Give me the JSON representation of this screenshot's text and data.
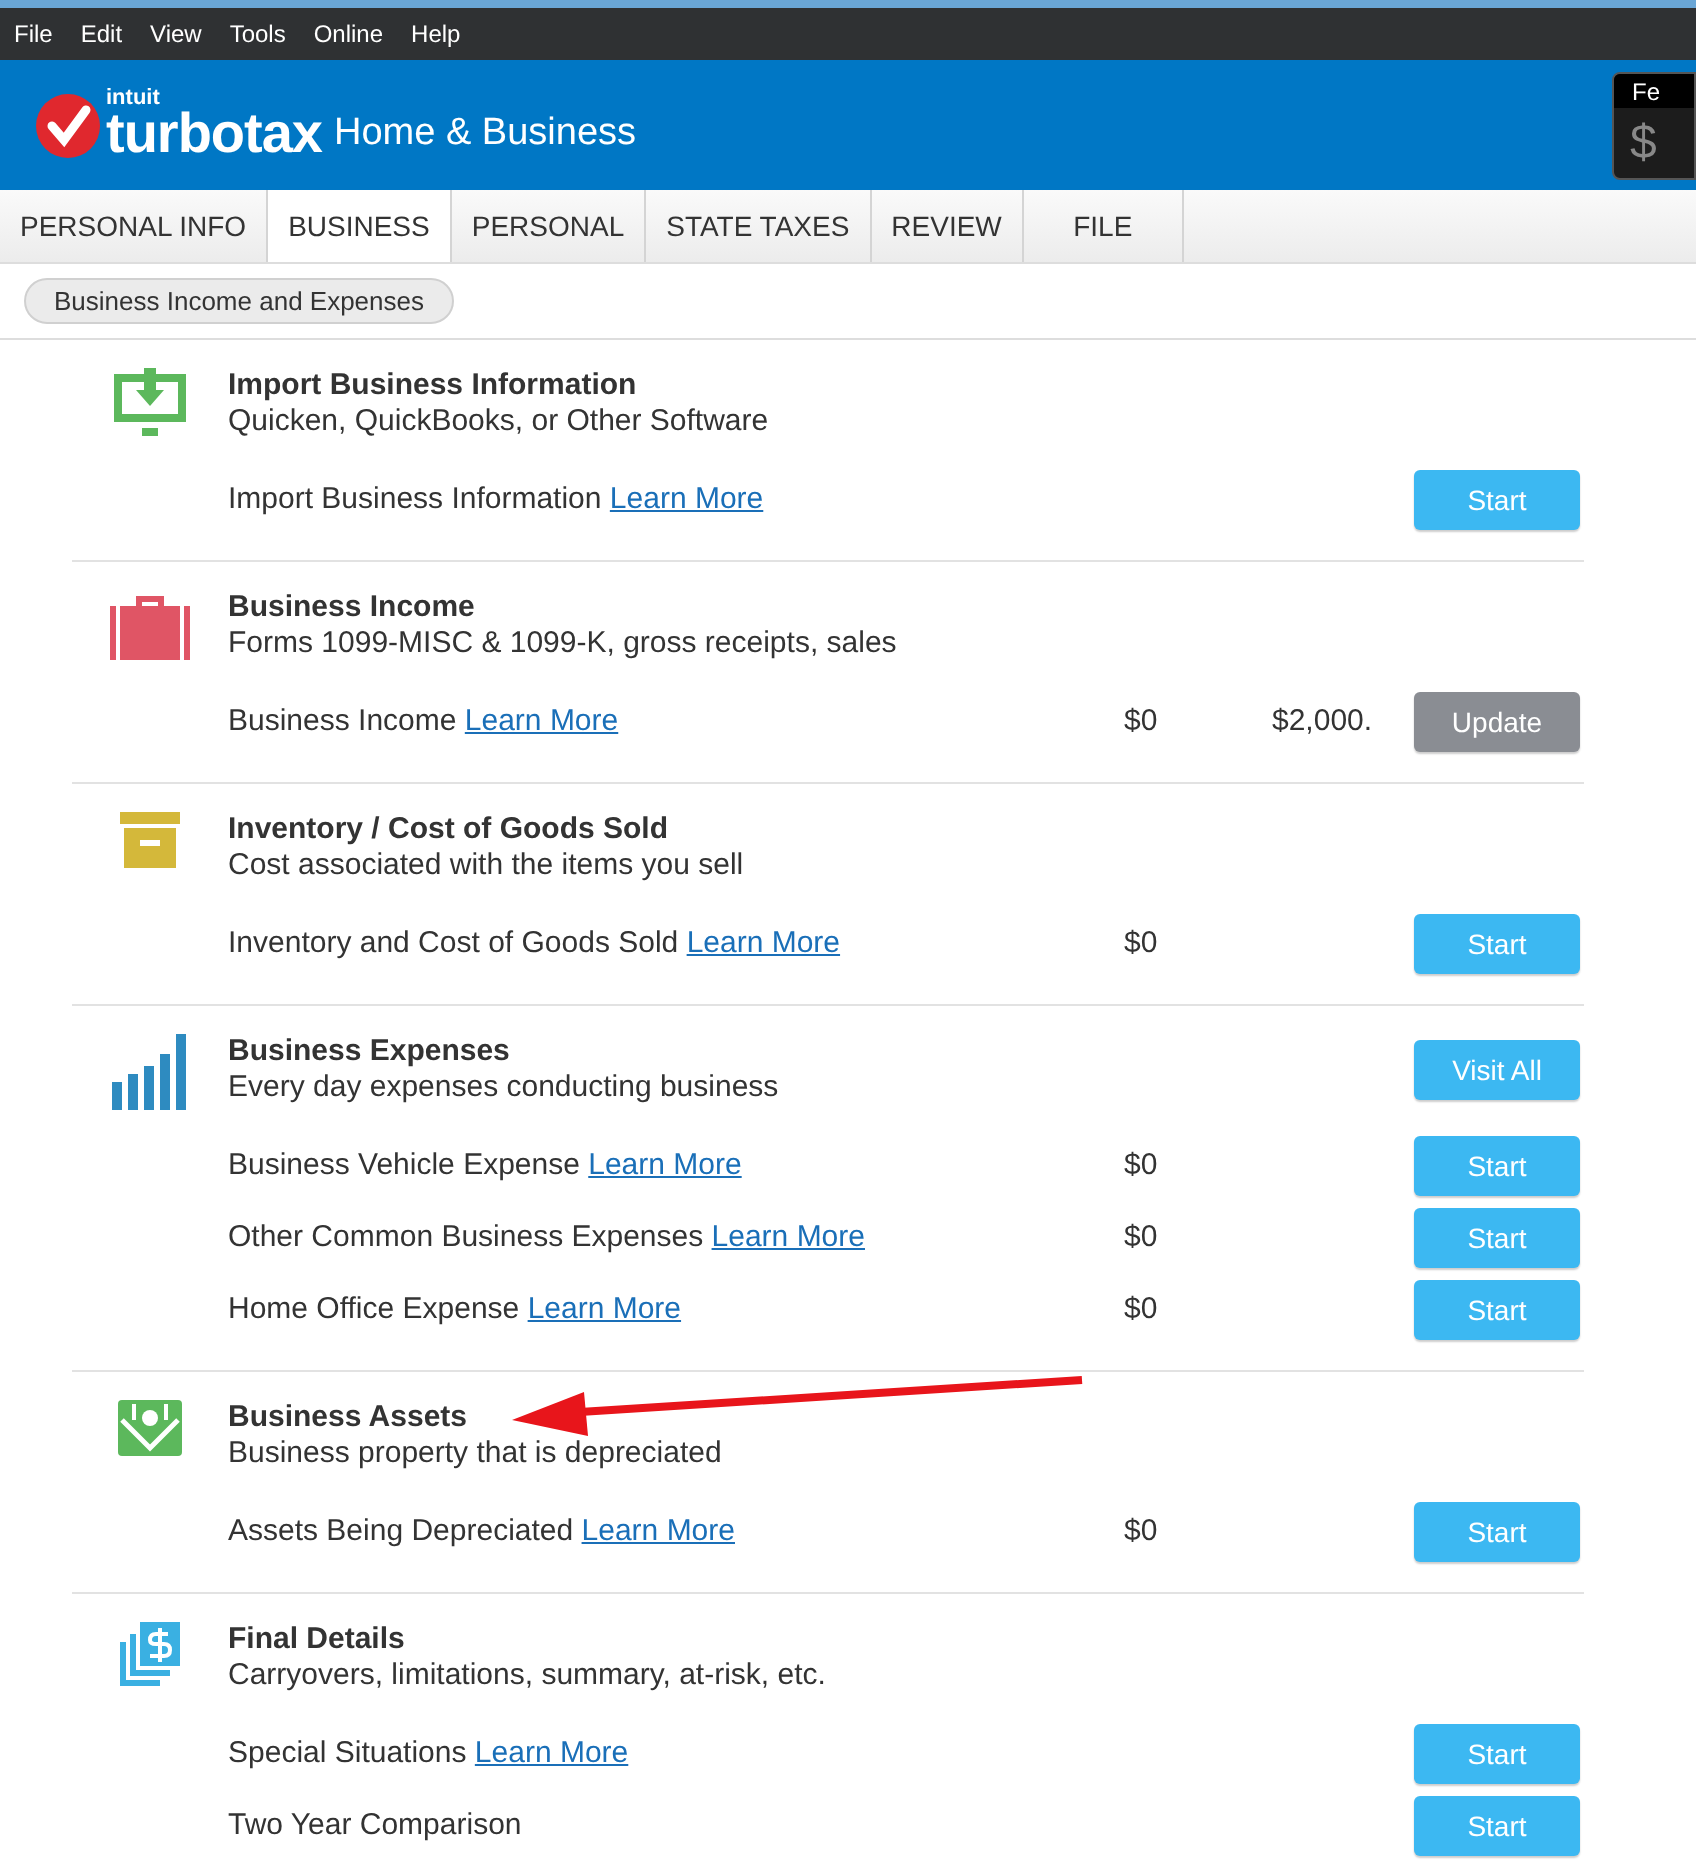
{
  "menu": [
    "File",
    "Edit",
    "View",
    "Tools",
    "Online",
    "Help"
  ],
  "header": {
    "brand_small": "intuit",
    "brand": "turbotax",
    "edition": "Home & Business",
    "meter": {
      "label": "Fe",
      "value": "$"
    }
  },
  "tabs": [
    {
      "label": "PERSONAL INFO",
      "selected": false
    },
    {
      "label": "BUSINESS",
      "selected": true
    },
    {
      "label": "PERSONAL",
      "selected": false
    },
    {
      "label": "STATE TAXES",
      "selected": false
    },
    {
      "label": "REVIEW",
      "selected": false
    },
    {
      "label": "FILE",
      "selected": false
    }
  ],
  "breadcrumb": "Business Income and Expenses",
  "sections": [
    {
      "title": "Import Business Information",
      "subtitle": "Quicken, QuickBooks, or Other Software",
      "rows": [
        {
          "label": "Import Business Information",
          "link": "Learn More",
          "button": {
            "label": "Start",
            "kind": "primary"
          }
        }
      ]
    },
    {
      "title": "Business Income",
      "subtitle": "Forms 1099-MISC & 1099-K, gross receipts, sales",
      "rows": [
        {
          "label": "Business Income",
          "link": "Learn More",
          "amount": "$0",
          "amount_2": "$2,000.",
          "button": {
            "label": "Update",
            "kind": "secondary"
          }
        }
      ]
    },
    {
      "title": "Inventory / Cost of Goods Sold",
      "subtitle": "Cost associated with the items you sell",
      "rows": [
        {
          "label": "Inventory and Cost of Goods Sold",
          "link": "Learn More",
          "amount": "$0",
          "button": {
            "label": "Start",
            "kind": "primary"
          }
        }
      ]
    },
    {
      "title": "Business Expenses",
      "subtitle": "Every day expenses conducting business",
      "button": {
        "label": "Visit All",
        "kind": "primary"
      },
      "rows": [
        {
          "label": "Business Vehicle Expense",
          "link": "Learn More",
          "amount": "$0",
          "button": {
            "label": "Start",
            "kind": "primary"
          }
        },
        {
          "label": "Other Common Business Expenses",
          "link": "Learn More",
          "amount": "$0",
          "button": {
            "label": "Start",
            "kind": "primary"
          }
        },
        {
          "label": "Home Office Expense",
          "link": "Learn More",
          "amount": "$0",
          "button": {
            "label": "Start",
            "kind": "primary"
          }
        }
      ]
    },
    {
      "title": "Business Assets",
      "subtitle": "Business property that is depreciated",
      "rows": [
        {
          "label": "Assets Being Depreciated",
          "link": "Learn More",
          "amount": "$0",
          "button": {
            "label": "Start",
            "kind": "primary"
          }
        }
      ]
    },
    {
      "title": "Final Details",
      "subtitle": "Carryovers, limitations, summary, at-risk, etc.",
      "rows": [
        {
          "label": "Special Situations",
          "link": "Learn More",
          "button": {
            "label": "Start",
            "kind": "primary"
          }
        },
        {
          "label": "Two Year Comparison",
          "button": {
            "label": "Start",
            "kind": "primary"
          }
        }
      ]
    }
  ]
}
